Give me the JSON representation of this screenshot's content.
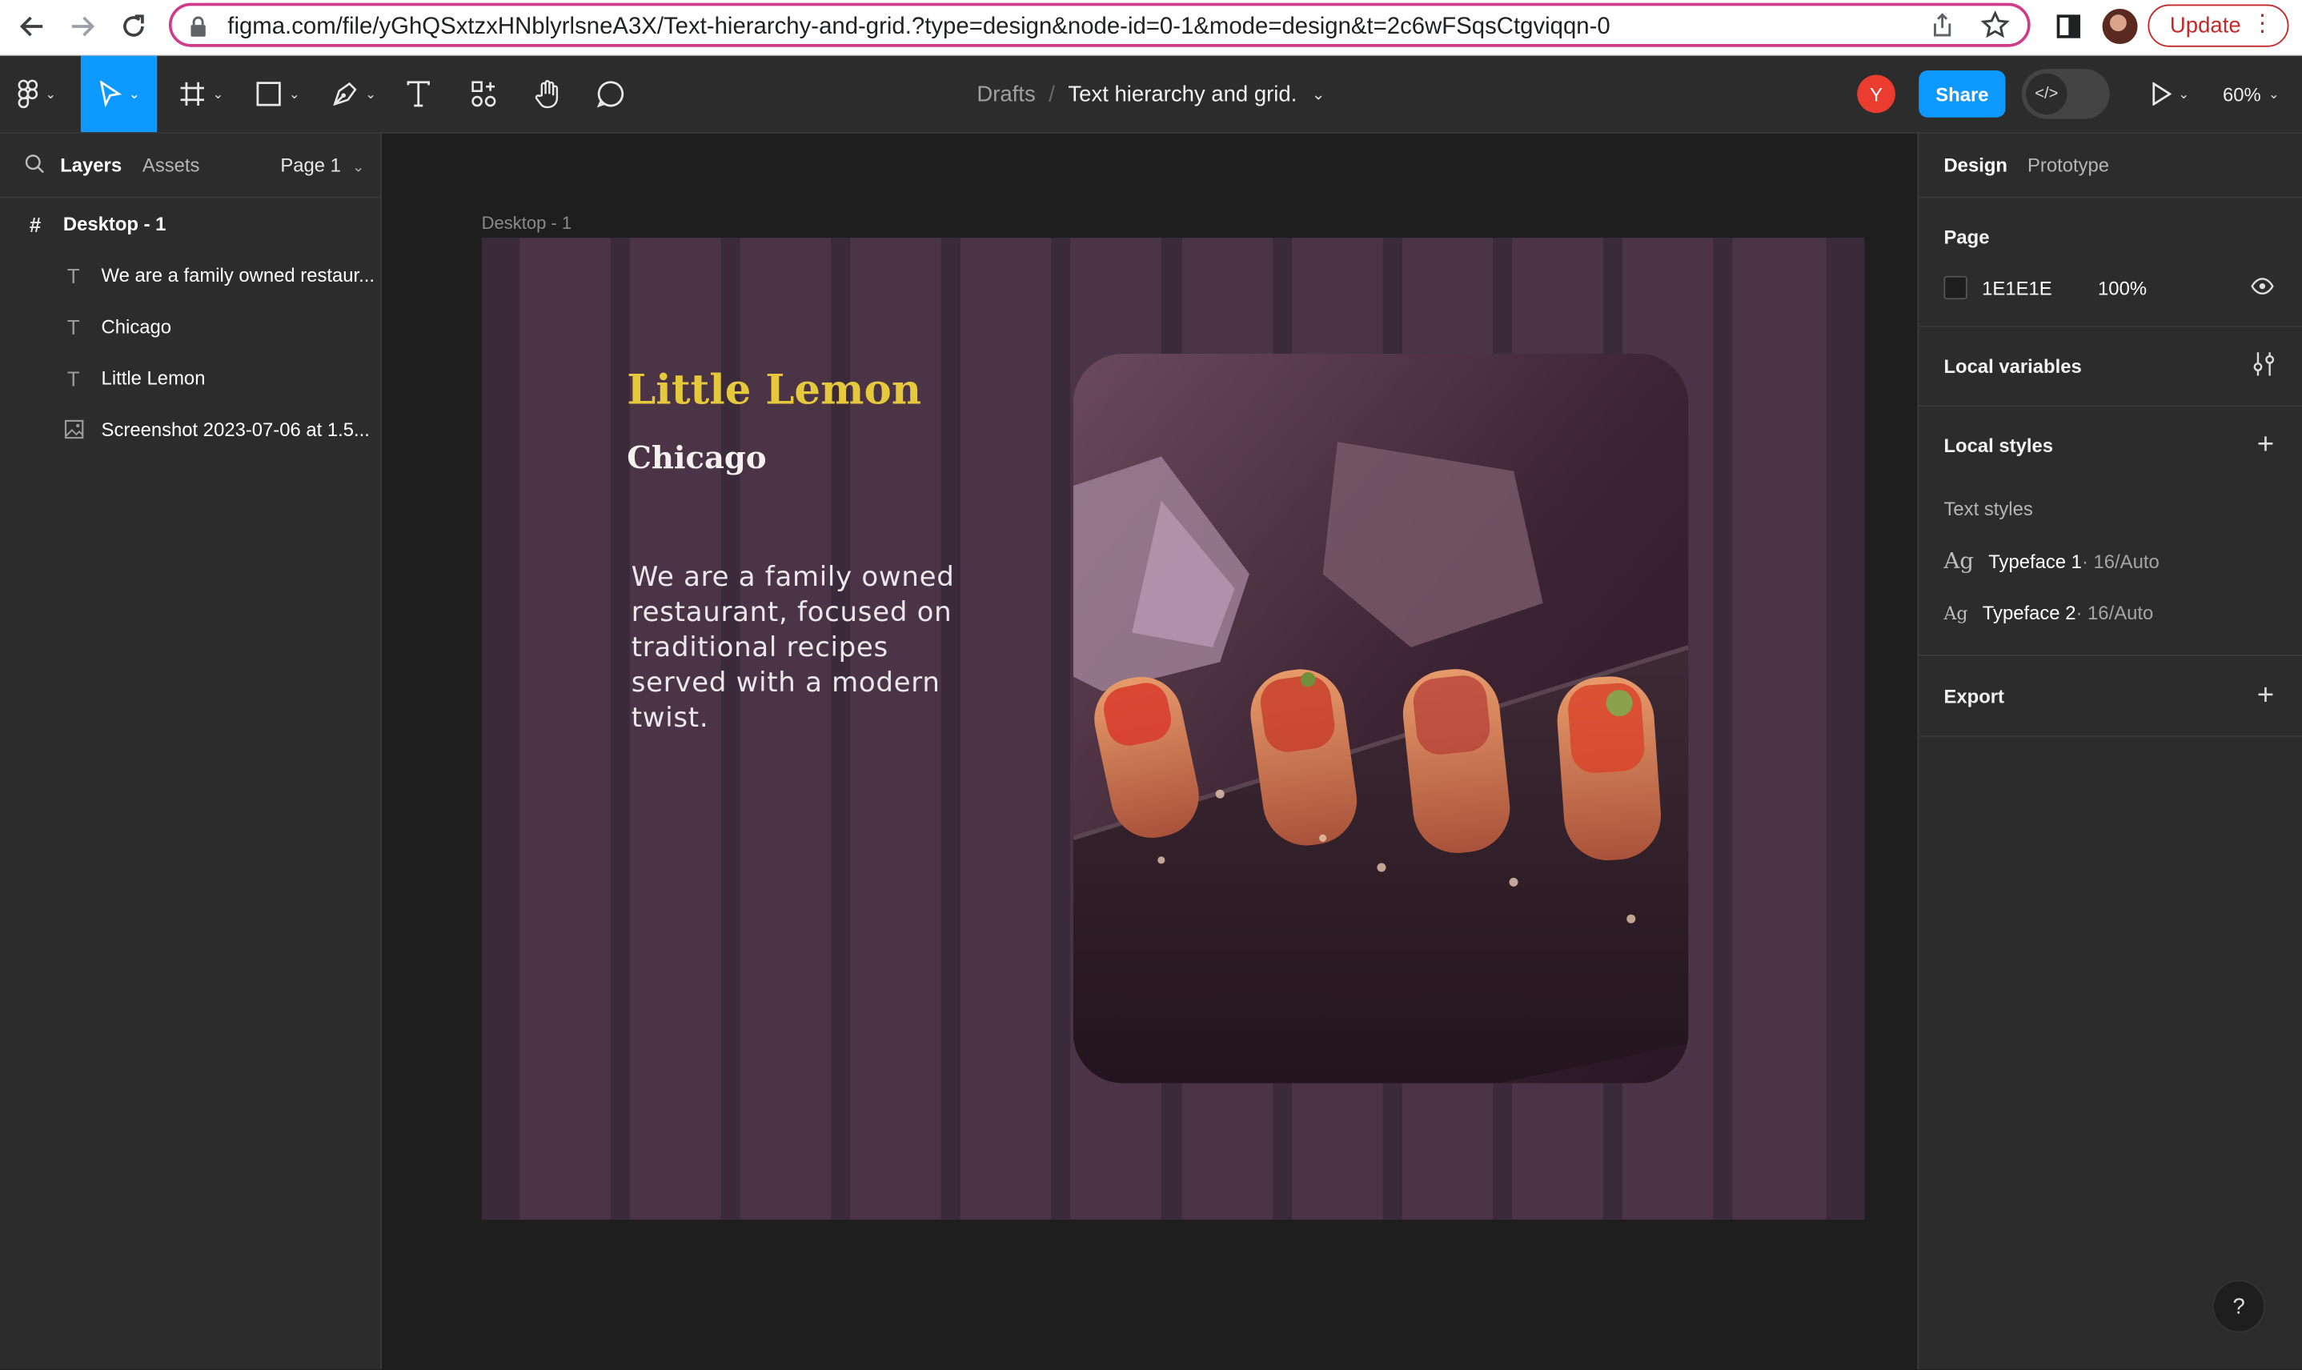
{
  "browser": {
    "url": "figma.com/file/yGhQSxtzxHNblyrlsneA3X/Text-hierarchy-and-grid.?type=design&node-id=0-1&mode=design&t=2c6wFSqsCtgviqqn-0",
    "update_label": "Update",
    "icons": [
      "back-arrow-icon",
      "forward-arrow-icon",
      "reload-icon",
      "lock-icon",
      "share-page-icon",
      "bookmark-star-icon",
      "side-panel-icon",
      "profile-avatar"
    ]
  },
  "toolbar": {
    "breadcrumb_root": "Drafts",
    "breadcrumb_sep": "/",
    "file_name": "Text hierarchy and grid.",
    "user_initial": "Y",
    "share_label": "Share",
    "zoom_label": "60%",
    "active_tool": "move",
    "accent_color": "#0d99ff"
  },
  "left_panel": {
    "tabs": [
      "Layers",
      "Assets"
    ],
    "page_selector": "Page 1",
    "frame_name": "Desktop - 1",
    "layers": [
      {
        "type": "text",
        "name": "We are a family owned restaur..."
      },
      {
        "type": "text",
        "name": "Chicago"
      },
      {
        "type": "text",
        "name": "Little Lemon"
      },
      {
        "type": "image",
        "name": "Screenshot 2023-07-06 at 1.5..."
      }
    ]
  },
  "canvas": {
    "frame_label": "Desktop - 1",
    "frame_bg": "#3a2a3a",
    "column_color": "#4a3446",
    "title": "Little Lemon",
    "title_color": "#e6c83c",
    "subtitle": "Chicago",
    "description": "We are a family owned restaurant, focused on traditional recipes served with a modern twist."
  },
  "right_panel": {
    "tabs": [
      "Design",
      "Prototype"
    ],
    "page_heading": "Page",
    "page_color_hex": "1E1E1E",
    "page_opacity": "100%",
    "local_variables": "Local variables",
    "local_styles": "Local styles",
    "text_styles_heading": "Text styles",
    "text_styles": [
      {
        "ag": "Ag",
        "name": "Typeface 1",
        "meta": " · 16/Auto"
      },
      {
        "ag": "Ag",
        "name": "Typeface 2",
        "meta": " · 16/Auto"
      }
    ],
    "export": "Export"
  },
  "help_label": "?"
}
